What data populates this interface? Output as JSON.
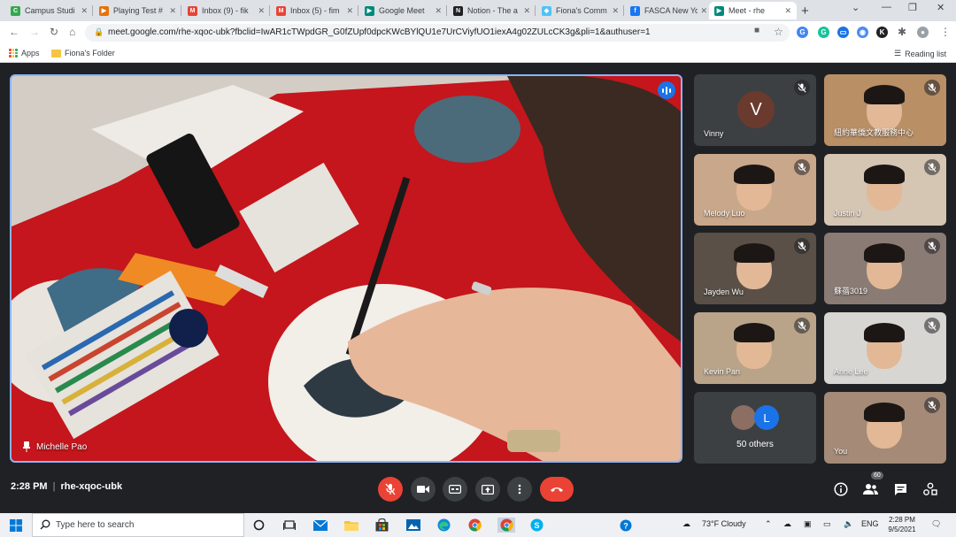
{
  "browser": {
    "tabs": [
      {
        "title": "Campus Studi",
        "favicon": "C",
        "color": "#34a853"
      },
      {
        "title": "Playing Test #",
        "favicon": "▶",
        "color": "#e8710a"
      },
      {
        "title": "Inbox (9) - fik",
        "favicon": "M",
        "color": "#ea4335"
      },
      {
        "title": "Inbox (5) - fim",
        "favicon": "M",
        "color": "#ea4335"
      },
      {
        "title": "Google Meet",
        "favicon": "▶",
        "color": "#00897b"
      },
      {
        "title": "Notion - The a",
        "favicon": "N",
        "color": "#202124"
      },
      {
        "title": "Fiona's Comm",
        "favicon": "◆",
        "color": "#4fc3f7"
      },
      {
        "title": "FASCA New Yo",
        "favicon": "f",
        "color": "#1877f2"
      },
      {
        "title": "Meet - rhe",
        "favicon": "▶",
        "color": "#00897b"
      }
    ],
    "url": "meet.google.com/rhe-xqoc-ubk?fbclid=IwAR1cTWpdGR_G0fZUpf0dpcKWcBYlQU1e7UrCViyfUO1iexA4g02ZULcCK3g&pli=1&authuser=1",
    "bookmarks": {
      "apps": "Apps",
      "folder": "Fiona's Folder",
      "reading_list": "Reading list"
    }
  },
  "meet": {
    "presenter": {
      "name": "Michelle Pao"
    },
    "participants": [
      {
        "name": "Vinny",
        "avatar": "V",
        "kind": "avatar"
      },
      {
        "name": "紐約華僑文教服務中心",
        "kind": "video",
        "bg": "#b98f66"
      },
      {
        "name": "Melody Luo",
        "kind": "video",
        "bg": "#c9a78a"
      },
      {
        "name": "Justin J",
        "kind": "video",
        "bg": "#d5c5b3"
      },
      {
        "name": "Jayden Wu",
        "kind": "video",
        "bg": "#5a5048"
      },
      {
        "name": "蘇蓓3019",
        "kind": "video",
        "bg": "#8a7b74"
      },
      {
        "name": "Kevin Pan",
        "kind": "video",
        "bg": "#b9a48a"
      },
      {
        "name": "Anne Lee",
        "kind": "video",
        "bg": "#d8d6d2"
      },
      {
        "name": "50 others",
        "kind": "others",
        "avatar": "L"
      },
      {
        "name": "You",
        "kind": "video",
        "bg": "#a48a77"
      }
    ],
    "meeting_time": "2:28 PM",
    "meeting_code": "rhe-xqoc-ubk",
    "people_count": "60"
  },
  "taskbar": {
    "search_placeholder": "Type here to search",
    "weather": "73°F  Cloudy",
    "language": "ENG",
    "time": "2:28 PM",
    "date": "9/5/2021"
  }
}
